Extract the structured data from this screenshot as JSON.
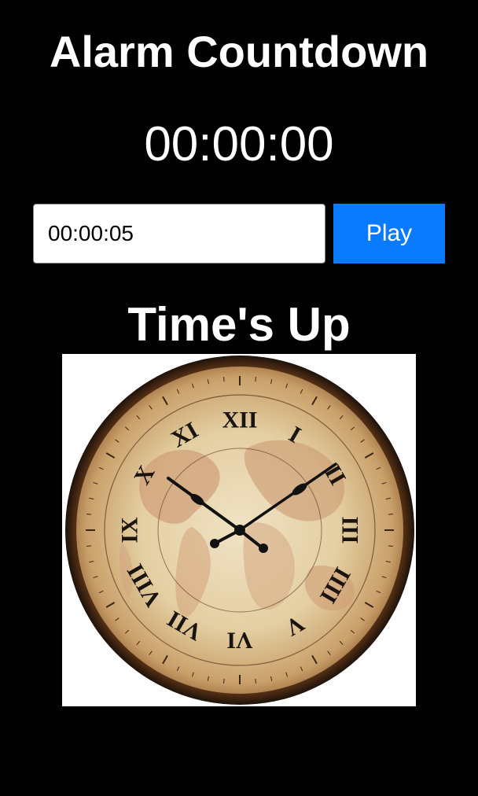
{
  "header": {
    "title": "Alarm Countdown"
  },
  "timer": {
    "display": "00:00:00"
  },
  "controls": {
    "time_input_value": "00:00:05",
    "play_label": "Play"
  },
  "status": {
    "message": "Time's Up"
  },
  "clock": {
    "numerals": [
      "XII",
      "I",
      "II",
      "III",
      "IIII",
      "V",
      "VI",
      "VII",
      "VIII",
      "IX",
      "X",
      "XI"
    ]
  },
  "colors": {
    "background": "#000000",
    "text": "#ffffff",
    "play_button": "#0a7bff"
  }
}
